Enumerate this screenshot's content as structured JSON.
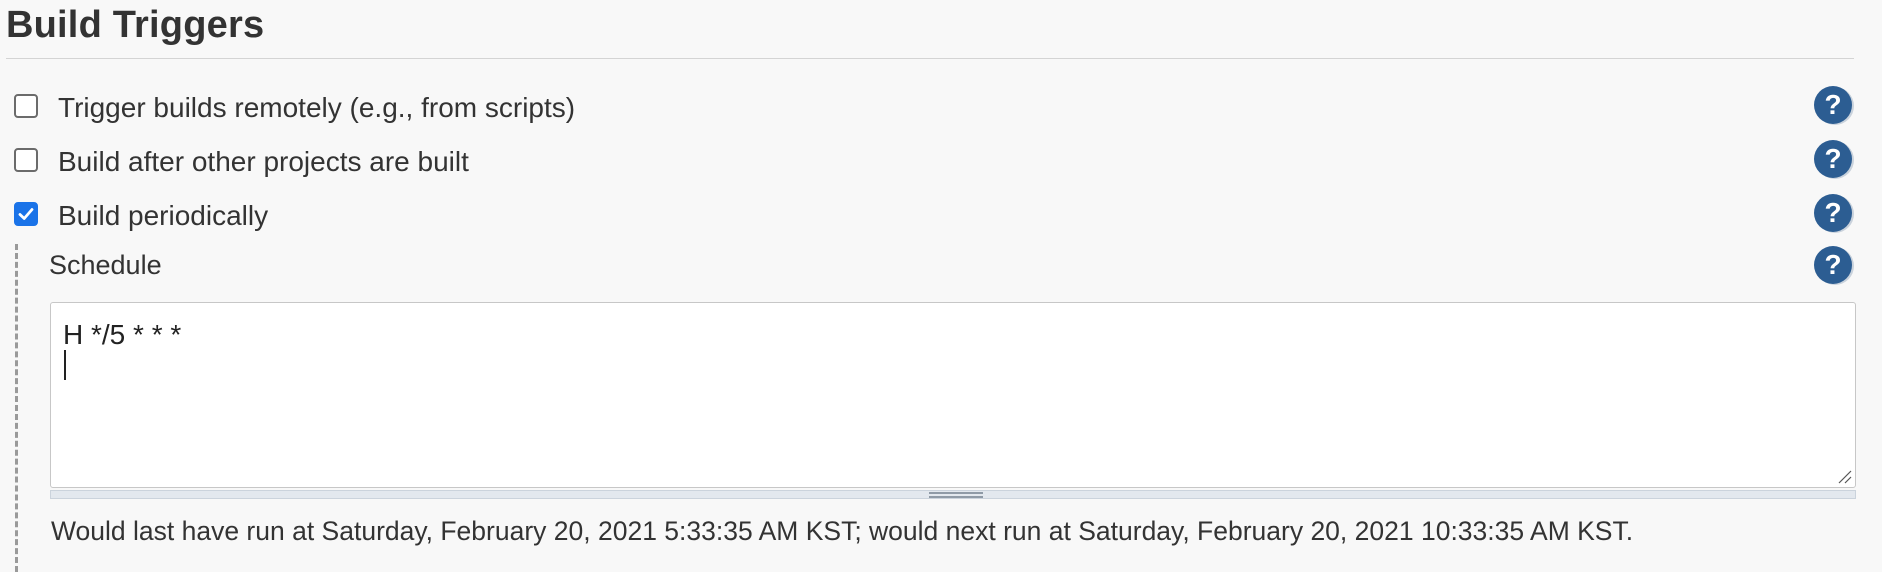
{
  "section": {
    "title": "Build Triggers"
  },
  "triggers": [
    {
      "label": "Trigger builds remotely (e.g., from scripts)",
      "checked": false,
      "help_icon": "question-mark-icon"
    },
    {
      "label": "Build after other projects are built",
      "checked": false,
      "help_icon": "question-mark-icon"
    },
    {
      "label": "Build periodically",
      "checked": true,
      "help_icon": "question-mark-icon"
    }
  ],
  "schedule": {
    "label": "Schedule",
    "help_icon": "question-mark-icon",
    "value": "H */5 * * *\n",
    "info": "Would last have run at Saturday, February 20, 2021 5:33:35 AM KST; would next run at Saturday, February 20, 2021 10:33:35 AM KST."
  },
  "help": {
    "glyph": "?"
  },
  "colors": {
    "help_icon_bg": "#2c5d92",
    "checkbox_checked": "#1a73e8",
    "background": "#f8f8f8",
    "text": "#333333"
  }
}
